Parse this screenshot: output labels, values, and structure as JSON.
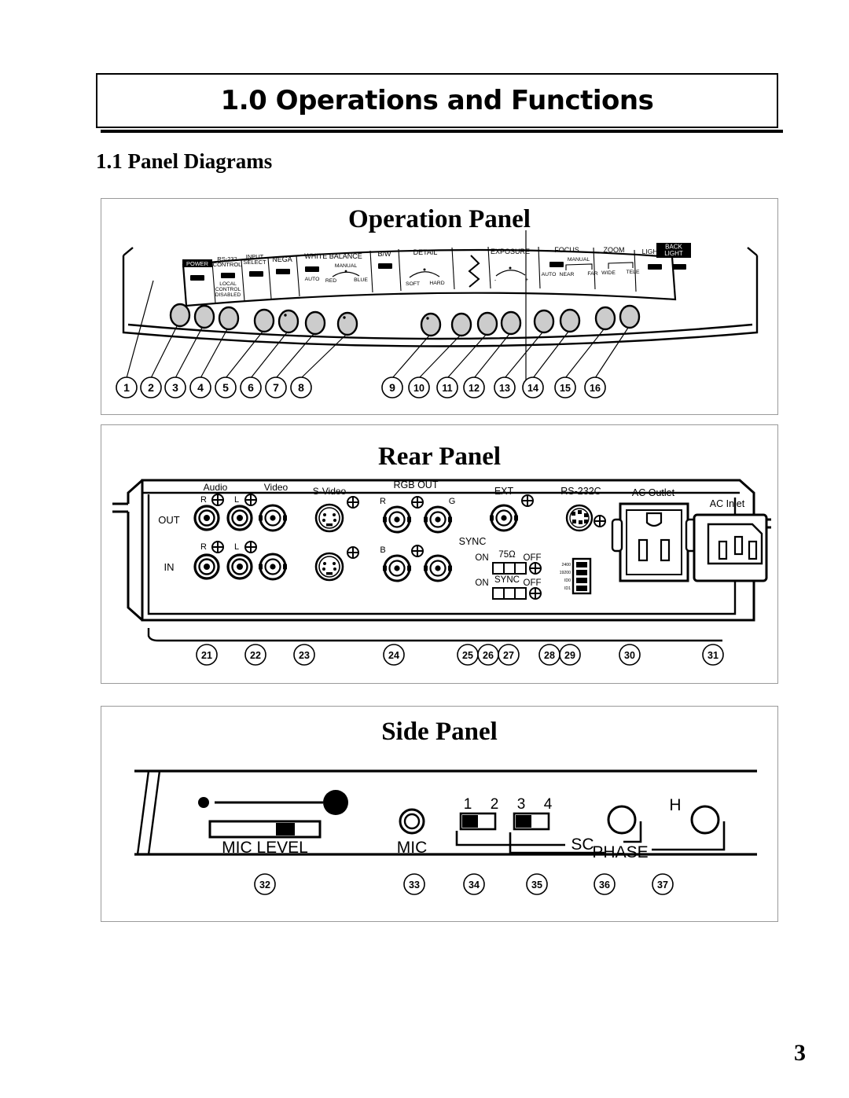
{
  "header": {
    "chapter_title": "1.0 Operations and Functions",
    "section_title": "1.1 Panel Diagrams"
  },
  "page_number": "3",
  "panels": [
    {
      "id": "operation",
      "title": "Operation Panel",
      "controls": [
        {
          "label": "POWER",
          "type": "button",
          "inverted": true
        },
        {
          "label": "RS-232 CONTROL",
          "sub": "LOCAL CONTROL DISABLED",
          "type": "button"
        },
        {
          "label": "INPUT SELECT",
          "type": "button"
        },
        {
          "label": "NEGA",
          "type": "button"
        },
        {
          "label": "WHITE BALANCE",
          "type": "group",
          "items": [
            "AUTO",
            "MANUAL",
            "RED",
            "BLUE"
          ]
        },
        {
          "label": "B/W",
          "type": "button"
        },
        {
          "label": "DETAIL",
          "type": "knob",
          "items": [
            "SOFT",
            "HARD"
          ]
        },
        {
          "label": "EXPOSURE",
          "type": "knob",
          "items": [
            "-",
            "+"
          ]
        },
        {
          "label": "FOCUS",
          "type": "group",
          "items": [
            "AUTO",
            "MANUAL",
            "NEAR",
            "FAR"
          ]
        },
        {
          "label": "ZOOM",
          "type": "group",
          "items": [
            "WIDE",
            "TELE"
          ]
        },
        {
          "label": "LIGHTS",
          "type": "button"
        },
        {
          "label": "BACK LIGHT",
          "type": "button"
        }
      ],
      "callouts": [
        "1",
        "2",
        "3",
        "4",
        "5",
        "6",
        "7",
        "8",
        "9",
        "10",
        "11",
        "12",
        "13",
        "14",
        "15",
        "16"
      ]
    },
    {
      "id": "rear",
      "title": "Rear Panel",
      "row_labels": [
        "OUT",
        "IN"
      ],
      "connector_groups": [
        {
          "label": "Audio",
          "items": [
            "R",
            "L"
          ]
        },
        {
          "label": "Video"
        },
        {
          "label": "S-Video"
        },
        {
          "label": "RGB OUT",
          "items": [
            "R",
            "G",
            "B"
          ]
        },
        {
          "label": "SYNC"
        },
        {
          "label": "EXT"
        },
        {
          "label": "RS-232C"
        },
        {
          "label": "AC Outlet"
        },
        {
          "label": "AC Inlet"
        }
      ],
      "switches": [
        {
          "label": "75Ω",
          "on": "ON",
          "off": "OFF"
        },
        {
          "label": "SYNC",
          "on": "ON",
          "off": "OFF"
        }
      ],
      "dip_labels": [
        "2400",
        "19200",
        "ID0",
        "ID1"
      ],
      "callouts": [
        "21",
        "22",
        "23",
        "24",
        "25",
        "26",
        "27",
        "28",
        "29",
        "30",
        "31"
      ]
    },
    {
      "id": "side",
      "title": "Side Panel",
      "controls": [
        {
          "label": "MIC LEVEL",
          "type": "slider"
        },
        {
          "label": "MIC",
          "type": "jack"
        },
        {
          "label": "SC",
          "type": "switch-pair",
          "items": [
            "1",
            "2",
            "3",
            "4"
          ]
        },
        {
          "label": "PHASE",
          "type": "knob-pair",
          "items": [
            "H"
          ]
        }
      ],
      "callouts": [
        "32",
        "33",
        "34",
        "35",
        "36",
        "37"
      ]
    }
  ],
  "colors": {
    "button_fill": "#000000",
    "knob_fill": "#cccccc",
    "frame": "#9a9a9a",
    "ink": "#000000"
  }
}
